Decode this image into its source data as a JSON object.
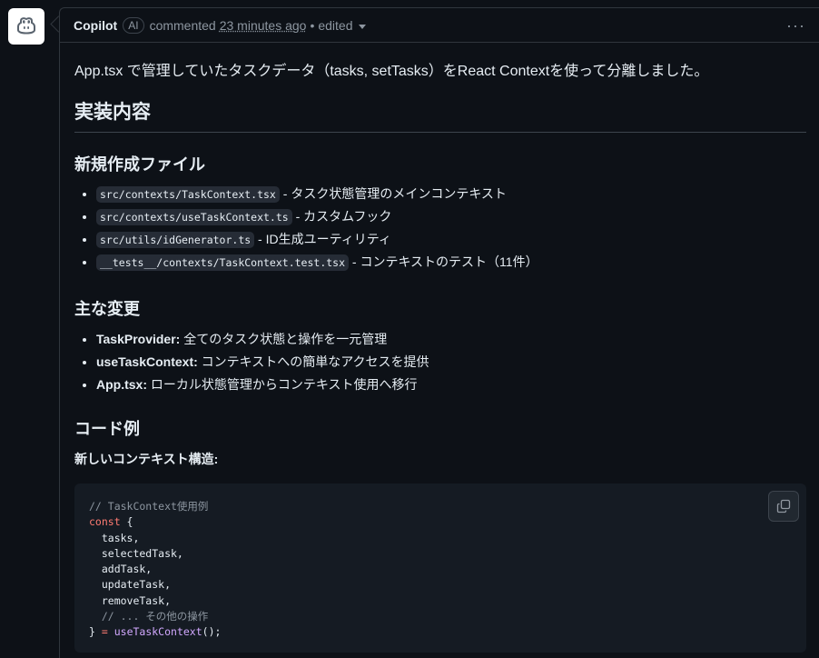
{
  "comment": {
    "author": "Copilot",
    "badge": "AI",
    "action": "commented",
    "time": "23 minutes ago",
    "separator": "•",
    "edited": "edited",
    "menu": "···"
  },
  "content": {
    "intro": "App.tsx で管理していたタスクデータ（tasks, setTasks）をReact Contextを使って分離しました。",
    "h1": "実装内容",
    "new_files_heading": "新規作成ファイル",
    "new_files": [
      {
        "code": "src/contexts/TaskContext.tsx",
        "desc": " - タスク状態管理のメインコンテキスト"
      },
      {
        "code": "src/contexts/useTaskContext.ts",
        "desc": " - カスタムフック"
      },
      {
        "code": "src/utils/idGenerator.ts",
        "desc": " - ID生成ユーティリティ"
      },
      {
        "code": "__tests__/contexts/TaskContext.test.tsx",
        "desc": " - コンテキストのテスト（11件）"
      }
    ],
    "changes_heading": "主な変更",
    "changes": [
      {
        "bold": "TaskProvider:",
        "desc": " 全てのタスク状態と操作を一元管理"
      },
      {
        "bold": "useTaskContext:",
        "desc": " コンテキストへの簡単なアクセスを提供"
      },
      {
        "bold": "App.tsx:",
        "desc": " ローカル状態管理からコンテキスト使用へ移行"
      }
    ],
    "code_heading": "コード例",
    "code_subheading": "新しいコンテキスト構造:",
    "code_lines": {
      "l1": "// TaskContext使用例",
      "l2_kw": "const",
      "l2_rest": " {",
      "l3": "  tasks,",
      "l4": "  selectedTask,",
      "l5": "  addTask,",
      "l6": "  updateTask,",
      "l7": "  removeTask,",
      "l8": "  // ... その他の操作",
      "l9_a": "} ",
      "l9_op": "=",
      "l9_fn": " useTaskContext",
      "l9_end": "();"
    }
  }
}
